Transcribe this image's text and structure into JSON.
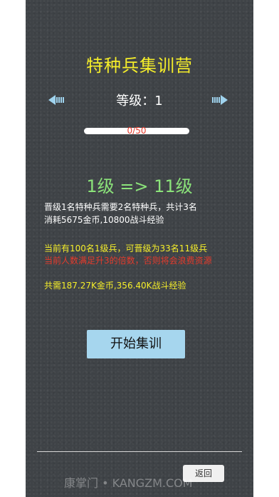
{
  "header": {
    "title": "特种兵集训营",
    "level_label": "等级：",
    "level_value": "1"
  },
  "progress": {
    "text": "0/50",
    "current": 0,
    "max": 50
  },
  "upgrade": {
    "headline": "1级 => 11级",
    "cost_line1": "晋级1名特种兵需要2名特种兵，共计3名",
    "cost_line2": "消耗5675金币,10800战斗经验",
    "current_line": "当前有100名1级兵，可晋级为33名11级兵",
    "warning_line": "当前人数满足升3的倍数，否则将会浪费资源",
    "total_line": "共需187.27K金币,356.40K战斗经验"
  },
  "buttons": {
    "start": "开始集训",
    "back": "返回"
  },
  "icons": {
    "prev": "left-arrow-icon",
    "next": "right-arrow-icon"
  },
  "colors": {
    "title": "#f5ee2a",
    "headline": "#8be37a",
    "warning": "#e53b2c",
    "button": "#a6d6ee"
  },
  "watermark": "康掌门 • KANGZM.COM"
}
